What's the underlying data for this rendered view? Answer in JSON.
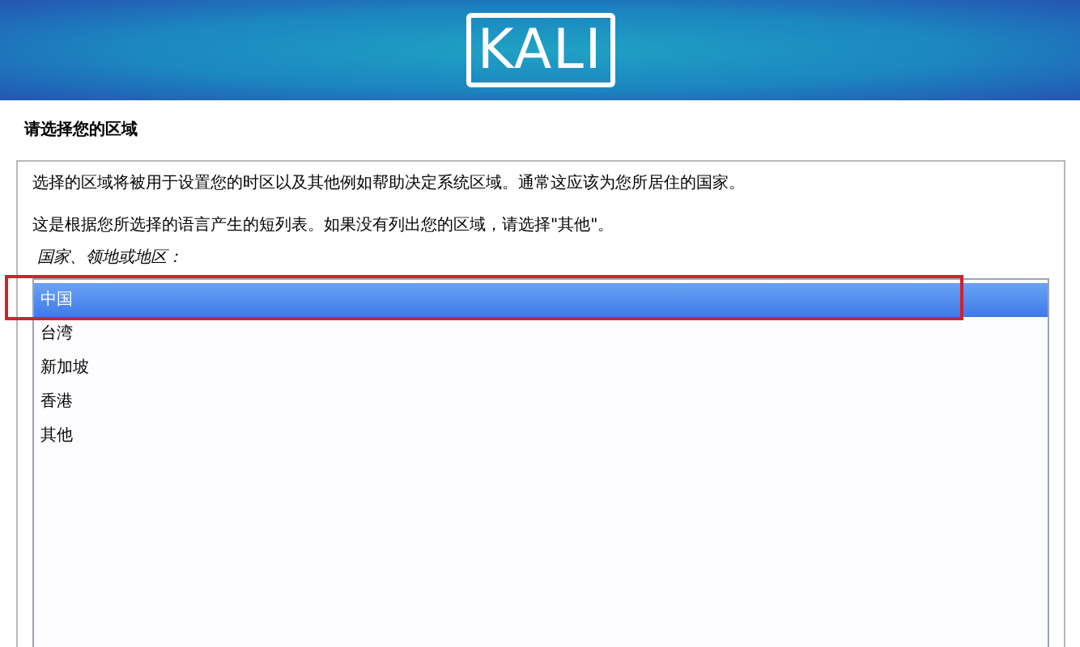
{
  "header": {
    "logo": "KALI"
  },
  "title": "请选择您的区域",
  "description": [
    "选择的区域将被用于设置您的时区以及其他例如帮助决定系统区域。通常这应该为您所居住的国家。",
    "这是根据您所选择的语言产生的短列表。如果没有列出您的区域，请选择\"其他\"。"
  ],
  "list_label": "国家、领地或地区：",
  "regions": [
    {
      "label": "中国",
      "selected": true
    },
    {
      "label": "台湾",
      "selected": false
    },
    {
      "label": "新加坡",
      "selected": false
    },
    {
      "label": "香港",
      "selected": false
    },
    {
      "label": "其他",
      "selected": false
    }
  ],
  "annotation": {
    "highlighted": true
  }
}
